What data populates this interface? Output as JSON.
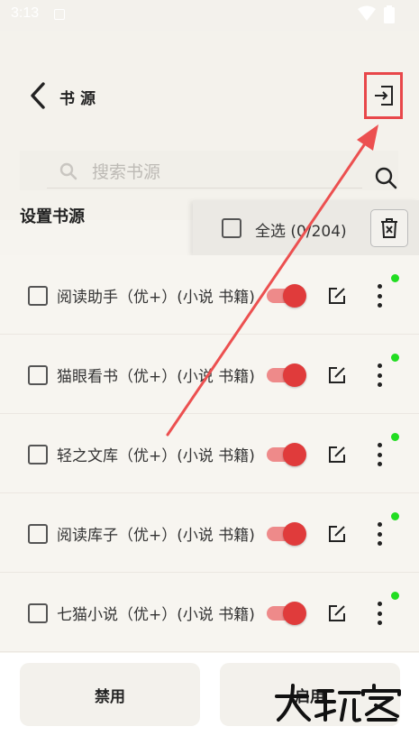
{
  "status_bar": {
    "time": "3:13",
    "icons": [
      "app-badge-icon",
      "wifi-icon",
      "battery-icon"
    ]
  },
  "header": {
    "back_icon": "chevron-left-icon",
    "title": "书源",
    "import_icon": "login-arrow-icon"
  },
  "search": {
    "placeholder": "搜索书源",
    "icon": "search-icon"
  },
  "section_title": "设置书源",
  "select_bar": {
    "select_all_label": "全选 (0/204)",
    "delete_icon": "trash-icon"
  },
  "sources": [
    {
      "name": "阅读助手（优+）(小说 书籍)",
      "enabled": true,
      "status_color": "#22dd22"
    },
    {
      "name": "猫眼看书（优+）(小说 书籍)",
      "enabled": true,
      "status_color": "#22dd22"
    },
    {
      "name": "轻之文库（优+）(小说 书籍)",
      "enabled": true,
      "status_color": "#22dd22"
    },
    {
      "name": "阅读库子（优+）(小说 书籍)",
      "enabled": true,
      "status_color": "#22dd22"
    },
    {
      "name": "七猫小说（优+）(小说 书籍)",
      "enabled": true,
      "status_color": "#22dd22"
    }
  ],
  "bottom": {
    "disable_label": "禁用",
    "enable_label": "启用"
  },
  "watermark": "大玩家",
  "colors": {
    "accent": "#e03b3b",
    "toggle_track": "#ee8a8a",
    "highlight_box": "#e8474a",
    "online_dot": "#22dd22"
  }
}
